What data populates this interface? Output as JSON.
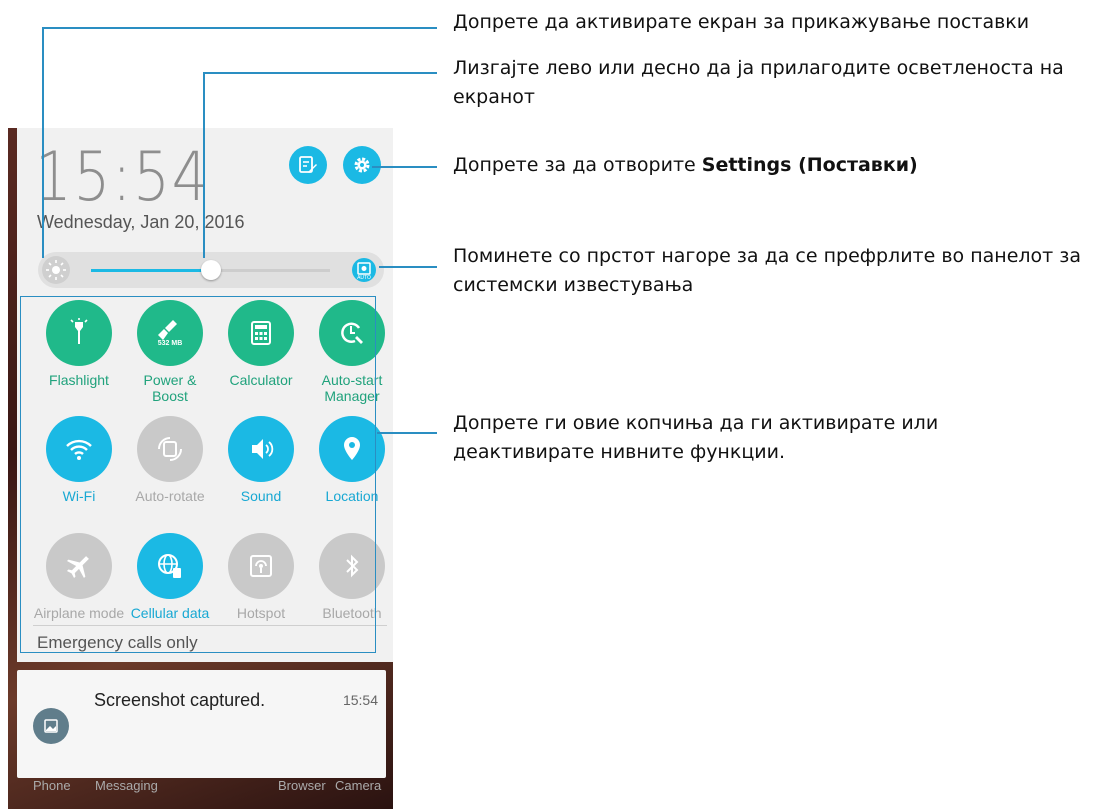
{
  "status": {
    "time": "15:54",
    "date": "Wednesday, Jan 20, 2016"
  },
  "header_icons": [
    "edit-icon",
    "gear-icon"
  ],
  "brightness": {
    "level": 0.5,
    "auto_label": "AUTO"
  },
  "tiles": [
    {
      "label": "Flashlight",
      "state": "on",
      "icon": "flashlight-icon"
    },
    {
      "label": "Power & Boost",
      "state": "on",
      "icon": "broom-icon",
      "badge": "532 MB"
    },
    {
      "label": "Calculator",
      "state": "on",
      "icon": "calculator-icon"
    },
    {
      "label": "Auto-start Manager",
      "state": "on",
      "icon": "autostart-icon"
    },
    {
      "label": "Wi-Fi",
      "state": "active",
      "icon": "wifi-icon"
    },
    {
      "label": "Auto-rotate",
      "state": "off",
      "icon": "rotate-icon"
    },
    {
      "label": "Sound",
      "state": "active",
      "icon": "speaker-icon"
    },
    {
      "label": "Location",
      "state": "active",
      "icon": "location-pin-icon"
    },
    {
      "label": "Airplane mode",
      "state": "off",
      "icon": "airplane-icon"
    },
    {
      "label": "Cellular data",
      "state": "active",
      "icon": "globe-icon"
    },
    {
      "label": "Hotspot",
      "state": "off",
      "icon": "hotspot-icon"
    },
    {
      "label": "Bluetooth",
      "state": "off",
      "icon": "bluetooth-icon"
    }
  ],
  "emergency": "Emergency calls only",
  "notification": {
    "title": "Screenshot captured.",
    "time": "15:54",
    "icon": "image-icon"
  },
  "dock": [
    "Phone",
    "Messaging",
    "Browser",
    "Camera"
  ],
  "callouts": {
    "c1": "Допрете да активирате екран за прикажување поставки",
    "c2": "Лизгајте лево или десно да ја прилагодите осветленоста на екранот",
    "c3_prefix": "Допрете за да отворите ",
    "c3_bold": "Settings (Поставки)",
    "c4": "Поминете со прстот нагоре за да се префрлите во панелот за системски известувања",
    "c5": "Допрете ги овие копчиња да ги активирате или деактивирате нивните функции."
  },
  "colors": {
    "accent": "#1bb9e4",
    "green": "#20b98a",
    "off": "#c9c9c9",
    "leader": "#2a8ec2"
  }
}
